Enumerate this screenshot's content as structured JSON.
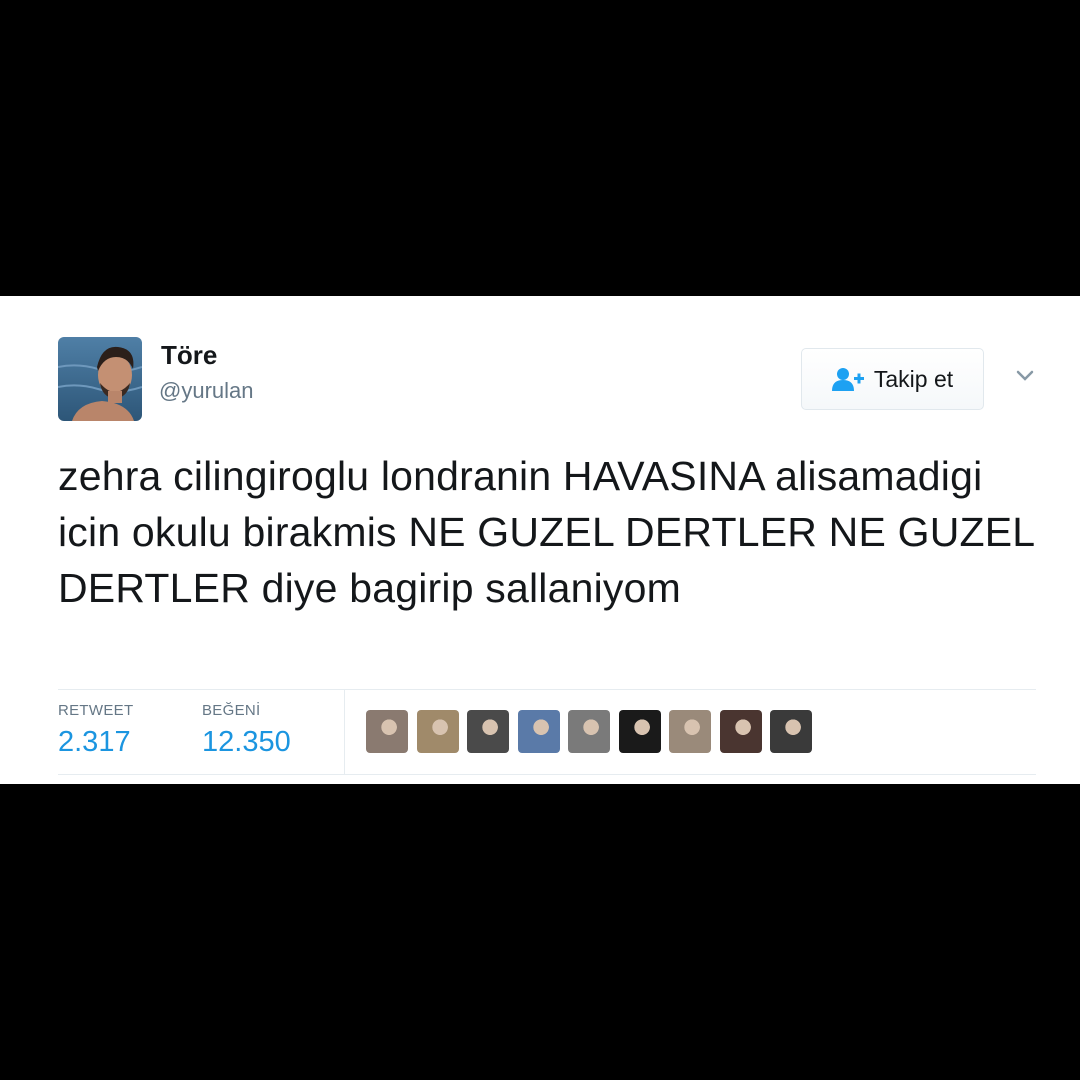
{
  "tweet": {
    "author": {
      "display_name": "Töre",
      "handle": "@yurulan",
      "avatar_icon": "profile-photo"
    },
    "follow_button": {
      "label": "Takip et",
      "icon": "add-user-icon",
      "icon_color": "#1da1f2"
    },
    "menu_icon": "chevron-down-icon",
    "text": "zehra cilingiroglu londranin HAVASINA alisamadigi icin okulu birakmis NE GUZEL DERTLER NE GUZEL DERTLER diye bagirip sallaniyom",
    "stats": {
      "retweet_label": "RETWEET",
      "retweet_count": "2.317",
      "like_label": "BEĞENİ",
      "like_count": "12.350",
      "count_color": "#1b95e0"
    },
    "likers": [
      {
        "name": "liker-avatar-1",
        "color": "#8a7a70"
      },
      {
        "name": "liker-avatar-2",
        "color": "#a08a6a"
      },
      {
        "name": "liker-avatar-3",
        "color": "#4a4a4a"
      },
      {
        "name": "liker-avatar-4",
        "color": "#5a7aa8"
      },
      {
        "name": "liker-avatar-5",
        "color": "#7a7a7a"
      },
      {
        "name": "liker-avatar-6",
        "color": "#1a1a1a"
      },
      {
        "name": "liker-avatar-7",
        "color": "#9a8a7a"
      },
      {
        "name": "liker-avatar-8",
        "color": "#4a3530"
      },
      {
        "name": "liker-avatar-9",
        "color": "#3a3a3a"
      }
    ]
  }
}
